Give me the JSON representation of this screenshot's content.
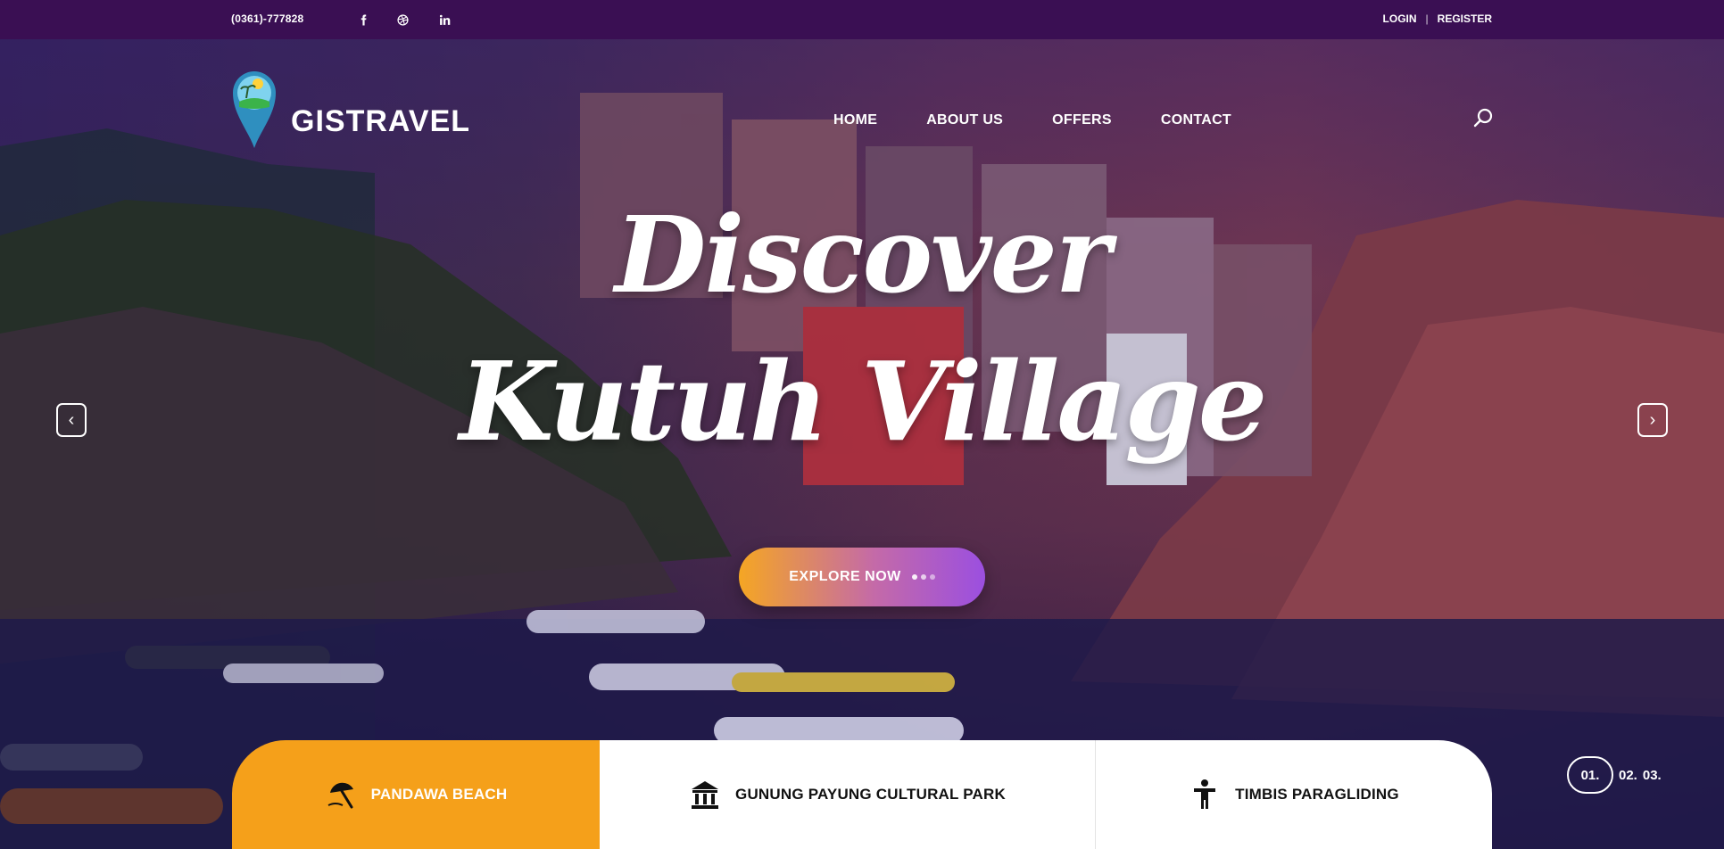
{
  "topbar": {
    "phone": "(0361)-777828",
    "social_icons": [
      "facebook-icon",
      "dribbble-icon",
      "linkedin-icon"
    ],
    "login": "LOGIN",
    "separator": "|",
    "register": "REGISTER"
  },
  "brand": {
    "name": "GISTRAVEL",
    "icon": "map-pin-island-icon"
  },
  "nav": {
    "items": [
      "HOME",
      "ABOUT US",
      "OFFERS",
      "CONTACT"
    ],
    "search_icon": "search-icon"
  },
  "hero": {
    "line1": "Discover",
    "line2": "Kutuh Village",
    "cta": "EXPLORE NOW",
    "prev_icon": "chevron-left-icon",
    "next_icon": "chevron-right-icon"
  },
  "tabs": [
    {
      "label": "PANDAWA BEACH",
      "icon": "beach-umbrella-icon",
      "active": true
    },
    {
      "label": "GUNUNG PAYUNG CULTURAL PARK",
      "icon": "museum-icon",
      "active": false
    },
    {
      "label": "TIMBIS PARAGLIDING",
      "icon": "person-icon",
      "active": false
    }
  ],
  "pager": {
    "items": [
      "01.",
      "02.",
      "03."
    ],
    "active_index": 0
  },
  "colors": {
    "topbar": "#3a0f53",
    "accent_orange": "#f5a01a",
    "cta_start": "#f5a623",
    "cta_end": "#9b4fe0"
  }
}
